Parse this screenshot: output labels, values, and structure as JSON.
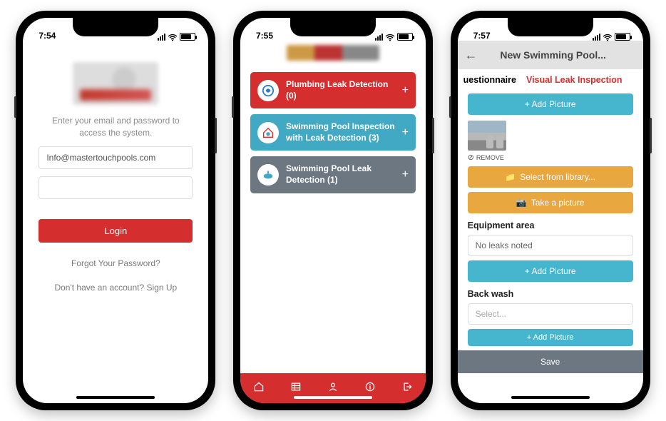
{
  "screen1": {
    "time": "7:54",
    "instruction": "Enter your email and password to access the system.",
    "email_value": "Info@mastertouchpools.com",
    "login_label": "Login",
    "forgot_label": "Forgot Your Password?",
    "signup_label": "Don't have an account? Sign Up"
  },
  "screen2": {
    "time": "7:55",
    "cards": [
      {
        "label": "Plumbing Leak Detection (0)"
      },
      {
        "label": "Swimming Pool Inspection with Leak Detection (3)"
      },
      {
        "label": "Swimming Pool Leak Detection (1)"
      }
    ]
  },
  "screen3": {
    "time": "7:57",
    "header_title": "New Swimming Pool...",
    "tab1": "uestionnaire",
    "tab2": "Visual Leak Inspection",
    "add_picture": "+ Add Picture",
    "remove": "REMOVE",
    "select_lib": "Select from library...",
    "take_pic": "Take a picture",
    "section_equipment": "Equipment area",
    "equipment_value": "No leaks noted",
    "section_backwash": "Back wash",
    "backwash_placeholder": "Select...",
    "save_label": "Save"
  }
}
